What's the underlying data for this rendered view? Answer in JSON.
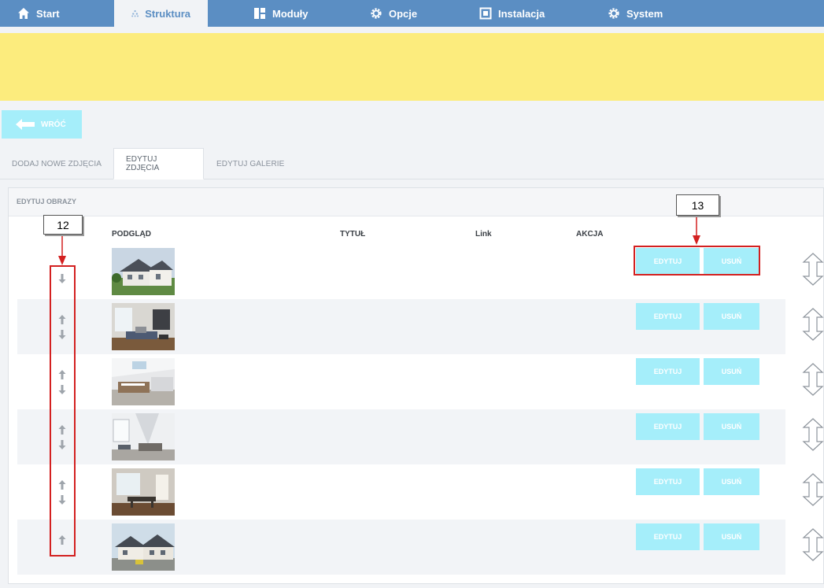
{
  "nav": {
    "items": [
      {
        "label": "Start",
        "icon": "home-icon"
      },
      {
        "label": "Struktura",
        "icon": "structure-icon",
        "active": true
      },
      {
        "label": "Moduły",
        "icon": "modules-icon"
      },
      {
        "label": "Opcje",
        "icon": "gear-icon"
      },
      {
        "label": "Instalacja",
        "icon": "install-icon"
      },
      {
        "label": "System",
        "icon": "gear-icon"
      }
    ]
  },
  "back_button": {
    "label": "WRÓĆ"
  },
  "tabs": [
    {
      "label": "DODAJ NOWE ZDJĘCIA"
    },
    {
      "label": "EDYTUJ ZDJĘCIA",
      "active": true
    },
    {
      "label": "EDYTUJ GALERIE"
    }
  ],
  "panel": {
    "title": "EDYTUJ OBRAZY",
    "columns": [
      "PODGLĄD",
      "TYTUŁ",
      "Link",
      "AKCJA"
    ],
    "rows": [
      {
        "thumb": "house-exterior",
        "up": false,
        "down": true,
        "edit": "EDYTUJ",
        "delete": "USUŃ"
      },
      {
        "thumb": "living-room",
        "up": true,
        "down": true,
        "edit": "EDYTUJ",
        "delete": "USUŃ"
      },
      {
        "thumb": "kitchen",
        "up": true,
        "down": true,
        "edit": "EDYTUJ",
        "delete": "USUŃ"
      },
      {
        "thumb": "stairs-interior",
        "up": true,
        "down": true,
        "edit": "EDYTUJ",
        "delete": "USUŃ"
      },
      {
        "thumb": "dining-room",
        "up": true,
        "down": true,
        "edit": "EDYTUJ",
        "delete": "USUŃ"
      },
      {
        "thumb": "house-street",
        "up": true,
        "down": false,
        "edit": "EDYTUJ",
        "delete": "USUŃ"
      }
    ]
  },
  "annotations": {
    "left_label": "12",
    "right_label": "13"
  },
  "colors": {
    "nav": "#5b8ec3",
    "banner": "#fcec7d",
    "button": "#a5eefa",
    "annotation": "#d32020"
  }
}
